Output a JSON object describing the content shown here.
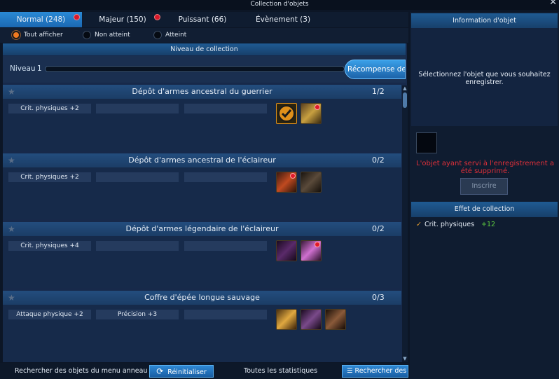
{
  "window": {
    "title": "Collection d'objets",
    "close": "✕"
  },
  "tabs": [
    {
      "label": "Normal (248)",
      "active": true,
      "has_dot": true
    },
    {
      "label": "Majeur (150)",
      "active": false,
      "has_dot": true
    },
    {
      "label": "Puissant (66)",
      "active": false,
      "has_dot": false
    },
    {
      "label": "Évènement (3)",
      "active": false,
      "has_dot": false
    }
  ],
  "filters": [
    {
      "label": "Tout afficher",
      "selected": true
    },
    {
      "label": "Non atteint",
      "selected": false
    },
    {
      "label": "Atteint",
      "selected": false
    }
  ],
  "level": {
    "header": "Niveau de collection",
    "label": "Niveau",
    "value": "1",
    "progress": 0,
    "reward_button": "Récompense de n"
  },
  "sections": [
    {
      "title": "Dépôt d'armes ancestral du guerrier",
      "count": "1/2",
      "stats": [
        "Crit. physiques +2",
        "",
        ""
      ],
      "items": [
        {
          "icon": "checkmark-icon",
          "color": "#e08a1a",
          "dot": false
        },
        {
          "icon": "golden-sword-icon",
          "color": "#c8a040",
          "dot": true
        }
      ]
    },
    {
      "title": "Dépôt d'armes ancestral de l'éclaireur",
      "count": "0/2",
      "stats": [
        "Crit. physiques +2",
        "",
        ""
      ],
      "items": [
        {
          "icon": "fire-dagger-icon",
          "color": "#c04a20",
          "dot": true
        },
        {
          "icon": "dark-dagger-icon",
          "color": "#5a4a3a",
          "dot": false
        }
      ]
    },
    {
      "title": "Dépôt d'armes légendaire de l'éclaireur",
      "count": "0/2",
      "stats": [
        "Crit. physiques +4",
        "",
        ""
      ],
      "items": [
        {
          "icon": "purple-blade-icon",
          "color": "#5a2a6a",
          "dot": false
        },
        {
          "icon": "violet-sword-icon",
          "color": "#a04aa0",
          "dot": true
        }
      ]
    },
    {
      "title": "Coffre d'épée longue sauvage",
      "count": "0/3",
      "stats": [
        "Attaque physique +2",
        "Précision +3",
        ""
      ],
      "items": [
        {
          "icon": "golden-longsword-icon",
          "color": "#c89030",
          "dot": false
        },
        {
          "icon": "purple-longsword-icon",
          "color": "#6a3a7a",
          "dot": false
        },
        {
          "icon": "bronze-longsword-icon",
          "color": "#7a4a2a",
          "dot": false
        }
      ]
    }
  ],
  "bottom": {
    "search_ring": "Rechercher des objets du menu anneau",
    "reset": "Réinitialiser",
    "all_stats": "Toutes les statistiques",
    "search_attr": "Rechercher des attrib"
  },
  "right": {
    "info_header": "Information d'objet",
    "info_text": "Sélectionnez l'objet que vous souhaitez enregistrer.",
    "warning": "L'objet ayant servi à l'enregistrement a été supprimé.",
    "register_button": "Inscrire",
    "effect_header": "Effet de collection",
    "effects": [
      {
        "label": "Crit. physiques",
        "value": "+12"
      }
    ]
  },
  "colors": {
    "accent": "#1b68b2",
    "warning": "#e0303a",
    "positive": "#5fd040",
    "radio_on": "#f07a20"
  }
}
